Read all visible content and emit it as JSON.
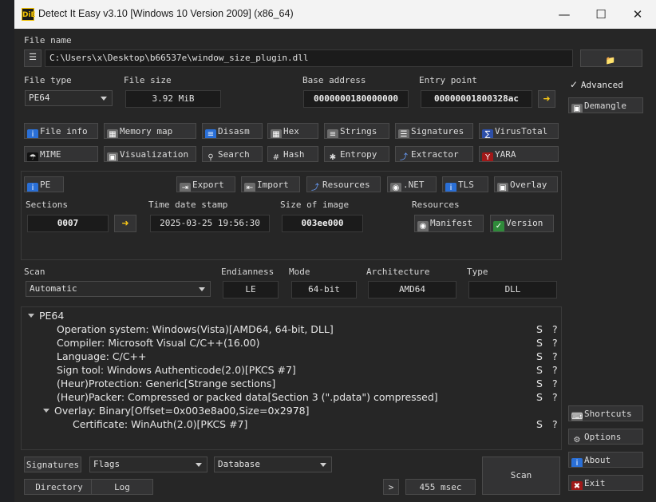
{
  "window": {
    "title": "Detect It Easy v3.10 [Windows 10 Version 2009] (x86_64)",
    "icon": "DiE"
  },
  "file": {
    "name_label": "File name",
    "path": "C:\\Users\\x\\Desktop\\b66537e\\window_size_plugin.dll"
  },
  "header": {
    "file_type_label": "File type",
    "file_type": "PE64",
    "file_size_label": "File size",
    "file_size": "3.92 MiB",
    "base_address_label": "Base address",
    "base_address": "0000000180000000",
    "entry_point_label": "Entry point",
    "entry_point": "00000001800328ac"
  },
  "tools_row1": [
    "File info",
    "Memory map",
    "Disasm",
    "Hex",
    "Strings",
    "Signatures",
    "VirusTotal"
  ],
  "tools_row2": [
    "MIME",
    "Visualization",
    "Search",
    "Hash",
    "Entropy",
    "Extractor",
    "YARA"
  ],
  "pe": {
    "pe_label": "PE",
    "export": "Export",
    "import": "Import",
    "resources_btn": "Resources",
    "net": ".NET",
    "tls": "TLS",
    "overlay": "Overlay",
    "sections_label": "Sections",
    "sections": "0007",
    "timestamp_label": "Time date stamp",
    "timestamp": "2025-03-25 19:56:30",
    "size_label": "Size of image",
    "size": "003ee000",
    "resources_label": "Resources",
    "manifest": "Manifest",
    "version": "Version"
  },
  "scan": {
    "scan_label": "Scan",
    "scan_mode": "Automatic",
    "endianness_label": "Endianness",
    "endianness": "LE",
    "mode_label": "Mode",
    "mode": "64-bit",
    "arch_label": "Architecture",
    "arch": "AMD64",
    "type_label": "Type",
    "type": "DLL"
  },
  "results": {
    "root": "PE64",
    "items": [
      {
        "text": "Operation system: Windows(Vista)[AMD64, 64-bit, DLL]",
        "s": "S",
        "q": "?"
      },
      {
        "text": "Compiler: Microsoft Visual C/C++(16.00)",
        "s": "S",
        "q": "?"
      },
      {
        "text": "Language: C/C++",
        "s": "S",
        "q": "?"
      },
      {
        "text": "Sign tool: Windows Authenticode(2.0)[PKCS #7]",
        "s": "S",
        "q": "?"
      },
      {
        "text": "(Heur)Protection: Generic[Strange sections]",
        "s": "S",
        "q": "?"
      },
      {
        "text": "(Heur)Packer: Compressed or packed data[Section 3 (\".pdata\") compressed]",
        "s": "S",
        "q": "?"
      }
    ],
    "overlay": "Overlay: Binary[Offset=0x003e8a00,Size=0x2978]",
    "certificate": {
      "text": "Certificate: WinAuth(2.0)[PKCS #7]",
      "s": "S",
      "q": "?"
    }
  },
  "bottom": {
    "signatures": "Signatures",
    "flags": "Flags",
    "database": "Database",
    "directory": "Directory",
    "log": "Log",
    "more": ">",
    "time": "455 msec",
    "scan": "Scan"
  },
  "side": {
    "advanced": "Advanced",
    "demangle": "Demangle",
    "shortcuts": "Shortcuts",
    "options": "Options",
    "about": "About",
    "exit": "Exit"
  }
}
